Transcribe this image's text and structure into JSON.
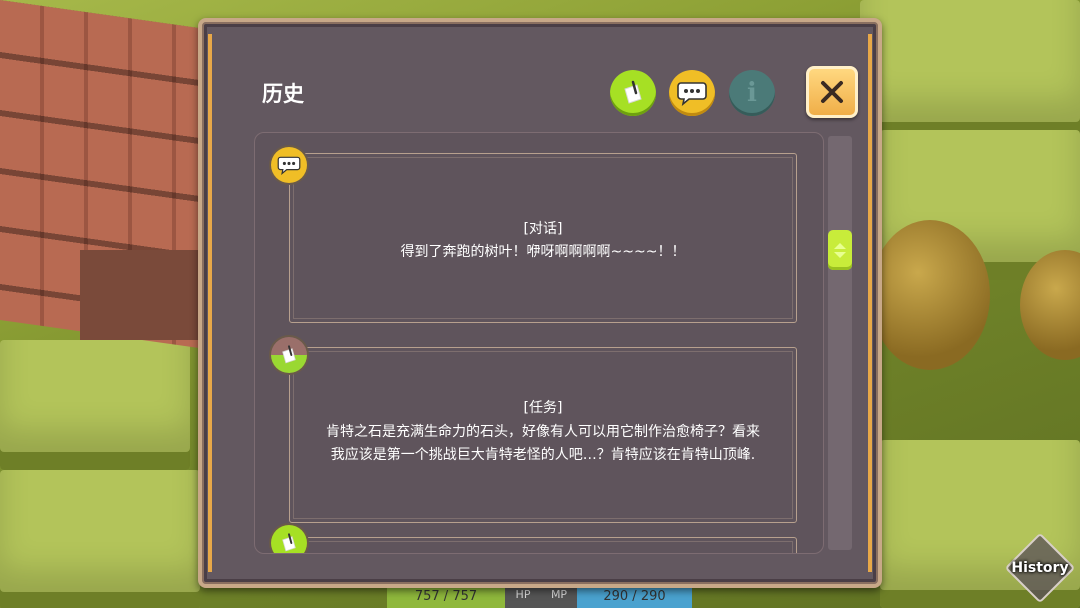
{
  "window": {
    "title": "历史"
  },
  "tabs": [
    {
      "name": "quest",
      "icon": "quill-paper-icon",
      "color": "#a6e024"
    },
    {
      "name": "dialog",
      "icon": "speech-bubble-icon",
      "color": "#f0be26"
    },
    {
      "name": "info",
      "icon": "info-icon",
      "glyph": "i",
      "color": "#4b7a78"
    }
  ],
  "close": {
    "icon": "close-icon",
    "glyph": "✕"
  },
  "entries": [
    {
      "type_label": "[对话]",
      "lines": [
        "得到了奔跑的树叶！咿呀啊啊啊啊~~~~！！"
      ],
      "icon": "speech-bubble-icon"
    },
    {
      "type_label": "[任务]",
      "lines": [
        "肯特之石是充满生命力的石头，好像有人可以用它制作治愈椅子？看来",
        "我应该是第一个挑战巨大肯特老怪的人吧…？肯特应该在肯特山顶峰."
      ],
      "icon": "quill-paper-icon"
    }
  ],
  "status": {
    "hp": "757 / 757",
    "hp_label": "HP",
    "mp_label": "MP",
    "mp": "290 / 290"
  },
  "history_button": {
    "label": "History"
  },
  "colors": {
    "panel_bg": "#635860",
    "accent_rail": "#e8a848",
    "scroll_thumb": "#c8ec3a"
  }
}
